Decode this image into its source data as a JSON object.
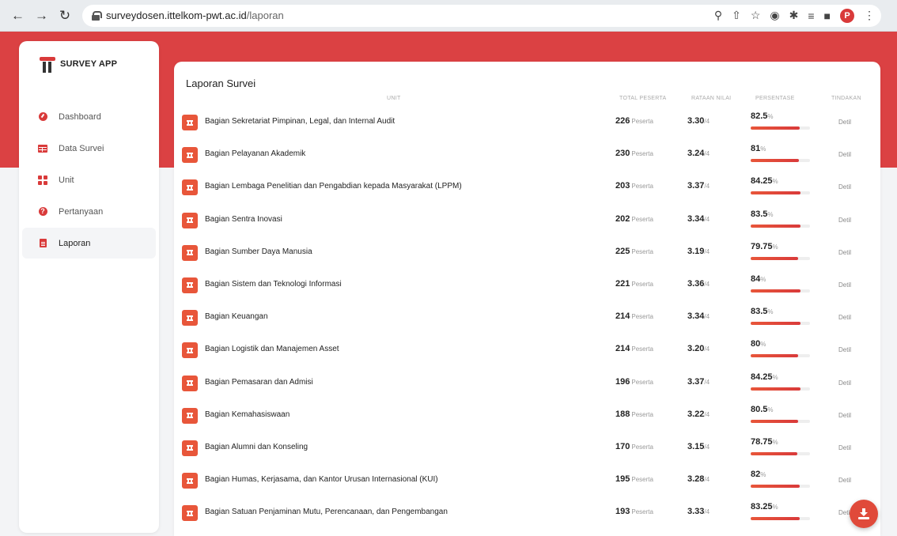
{
  "browser": {
    "url_host": "surveydosen.ittelkom-pwt.ac.id",
    "url_path": "/laporan",
    "profile_initial": "P"
  },
  "brand": {
    "name": "SURVEY APP"
  },
  "sidebar": {
    "items": [
      {
        "label": "Dashboard",
        "icon": "dashboard-icon"
      },
      {
        "label": "Data Survei",
        "icon": "table-icon"
      },
      {
        "label": "Unit",
        "icon": "grid-icon"
      },
      {
        "label": "Pertanyaan",
        "icon": "question-icon"
      },
      {
        "label": "Laporan",
        "icon": "document-icon",
        "active": true
      }
    ]
  },
  "report": {
    "title": "Laporan Survei",
    "columns": {
      "unit": "UNIT",
      "total": "TOTAL PESERTA",
      "rating": "RATAAN NILAI",
      "percent": "PERSENTASE",
      "action": "TINDAKAN"
    },
    "peserta_suffix": "Peserta",
    "rating_suffix": "/4",
    "percent_suffix": "%",
    "action_label": "Detil",
    "rows": [
      {
        "unit": "Bagian Sekretariat Pimpinan, Legal, dan Internal Audit",
        "peserta": "226",
        "rating": "3.30",
        "percent": "82.5"
      },
      {
        "unit": "Bagian Pelayanan Akademik",
        "peserta": "230",
        "rating": "3.24",
        "percent": "81"
      },
      {
        "unit": "Bagian Lembaga Penelitian dan Pengabdian kepada Masyarakat (LPPM)",
        "peserta": "203",
        "rating": "3.37",
        "percent": "84.25"
      },
      {
        "unit": "Bagian Sentra Inovasi",
        "peserta": "202",
        "rating": "3.34",
        "percent": "83.5"
      },
      {
        "unit": "Bagian Sumber Daya Manusia",
        "peserta": "225",
        "rating": "3.19",
        "percent": "79.75"
      },
      {
        "unit": "Bagian Sistem dan Teknologi Informasi",
        "peserta": "221",
        "rating": "3.36",
        "percent": "84"
      },
      {
        "unit": "Bagian Keuangan",
        "peserta": "214",
        "rating": "3.34",
        "percent": "83.5"
      },
      {
        "unit": "Bagian Logistik dan Manajemen Asset",
        "peserta": "214",
        "rating": "3.20",
        "percent": "80"
      },
      {
        "unit": "Bagian Pemasaran dan Admisi",
        "peserta": "196",
        "rating": "3.37",
        "percent": "84.25"
      },
      {
        "unit": "Bagian Kemahasiswaan",
        "peserta": "188",
        "rating": "3.22",
        "percent": "80.5"
      },
      {
        "unit": "Bagian Alumni dan Konseling",
        "peserta": "170",
        "rating": "3.15",
        "percent": "78.75"
      },
      {
        "unit": "Bagian Humas, Kerjasama, dan Kantor Urusan Internasional (KUI)",
        "peserta": "195",
        "rating": "3.28",
        "percent": "82"
      },
      {
        "unit": "Bagian Satuan Penjaminan Mutu, Perencanaan, dan Pengembangan",
        "peserta": "193",
        "rating": "3.33",
        "percent": "83.25"
      }
    ]
  },
  "colors": {
    "accent": "#db4143",
    "icon_bg": "#e8563a"
  }
}
